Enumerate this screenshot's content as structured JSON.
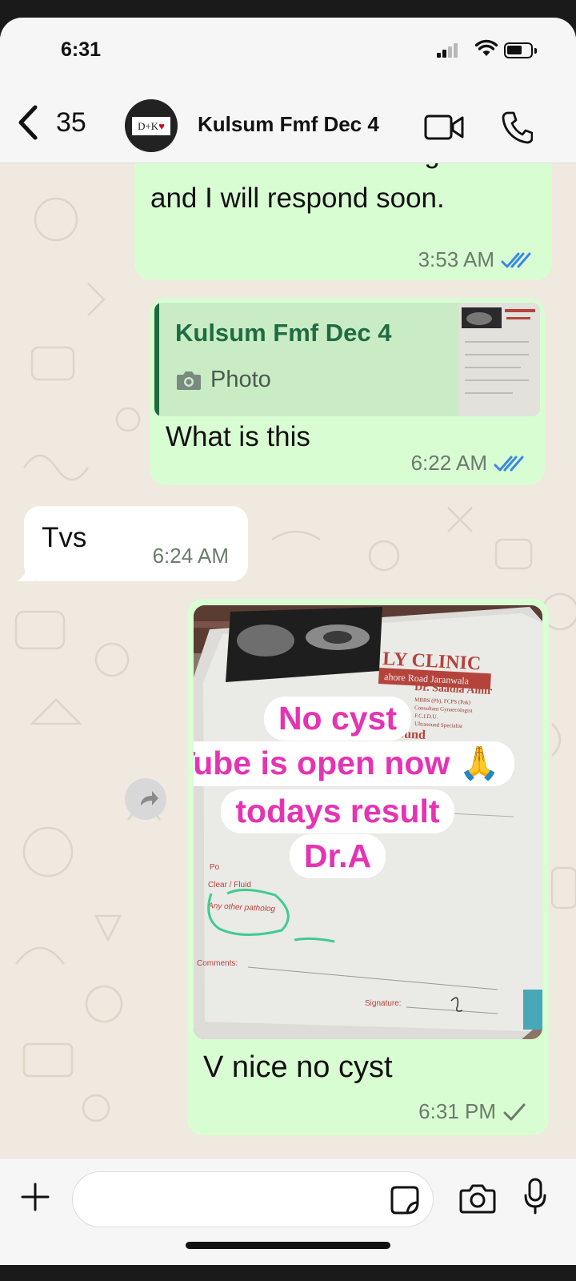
{
  "status_bar": {
    "time": "6:31"
  },
  "header": {
    "back_count": "35",
    "chat_name": "Kulsum Fmf Dec 4",
    "avatar_text": "D+K"
  },
  "messages": [
    {
      "text": "Please leave a message\nand I will respond soon.",
      "time": "3:53 AM",
      "status": "read"
    },
    {
      "quoted_author": "Kulsum Fmf Dec 4",
      "quoted_type": "Photo",
      "text": "What is this",
      "time": "6:22 AM",
      "status": "read"
    },
    {
      "text": "Tvs",
      "time": "6:24 AM"
    },
    {
      "image_text": {
        "clinic": "LY CLINIC",
        "address": "ahore Road Jaranwala",
        "doctor": "Dr. Saadia Amir",
        "credentials": [
          "MBBS (Pb), FCPS (Pak)",
          "Consultant Gynaecologist",
          "F.C.I.D.U.",
          "Ultrasound Specialist"
        ],
        "report": "al Ultrasound",
        "form_fields": [
          "Po",
          "Clear / Fluid",
          "Any other patholog",
          "Comments:",
          "Signature:"
        ]
      },
      "stickers": [
        "No cyst",
        "Tube is open now 🙏",
        "todays result",
        "Dr.A"
      ],
      "caption": "V nice no cyst",
      "time": "6:31 PM",
      "status": "sent"
    }
  ],
  "colors": {
    "outgoing": "#d9fdd3",
    "incoming": "#ffffff",
    "read_tick": "#3a87e8",
    "sticker_text": "#e434b4",
    "quote_bar": "#1c6b3d"
  }
}
